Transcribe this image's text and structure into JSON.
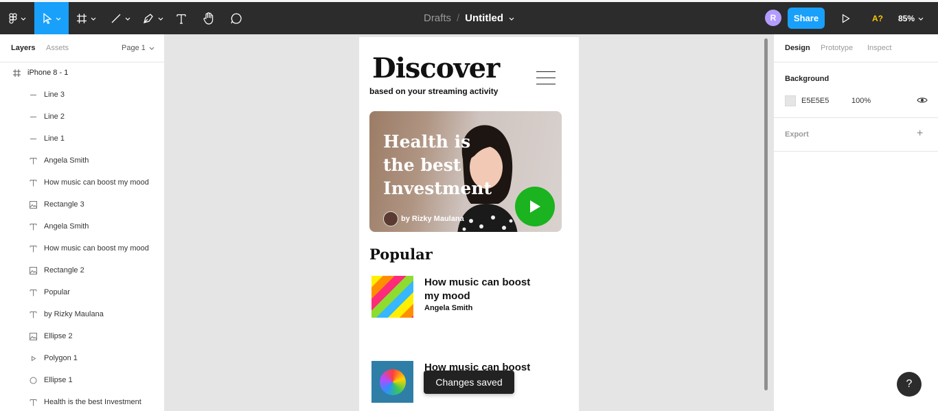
{
  "toolbar": {
    "breadcrumb_drafts": "Drafts",
    "breadcrumb_sep": "/",
    "file_title": "Untitled",
    "avatar_initial": "R",
    "share_label": "Share",
    "a_label": "A?",
    "zoom_level": "85%"
  },
  "left_panel": {
    "tab_layers": "Layers",
    "tab_assets": "Assets",
    "page": "Page 1",
    "frame_layer": "iPhone 8 - 1",
    "layers": [
      {
        "icon": "line-icon",
        "label": "Line 3"
      },
      {
        "icon": "line-icon",
        "label": "Line 2"
      },
      {
        "icon": "line-icon",
        "label": "Line 1"
      },
      {
        "icon": "text-icon",
        "label": "Angela Smith"
      },
      {
        "icon": "text-icon",
        "label": "How music can boost my mood"
      },
      {
        "icon": "image-icon",
        "label": "Rectangle 3"
      },
      {
        "icon": "text-icon",
        "label": "Angela Smith"
      },
      {
        "icon": "text-icon",
        "label": "How music can boost my mood"
      },
      {
        "icon": "image-icon",
        "label": "Rectangle 2"
      },
      {
        "icon": "text-icon",
        "label": "Popular"
      },
      {
        "icon": "text-icon",
        "label": "by Rizky Maulana"
      },
      {
        "icon": "image-icon",
        "label": "Ellipse 2"
      },
      {
        "icon": "polygon-icon",
        "label": "Polygon 1"
      },
      {
        "icon": "ellipse-icon",
        "label": "Ellipse 1"
      },
      {
        "icon": "text-icon",
        "label": "Health is the best Investment"
      }
    ]
  },
  "canvas": {
    "title": "Discover",
    "subtitle": "based on your streaming activity",
    "hero_title_lines": [
      "Health is",
      "the best",
      "Investment"
    ],
    "hero_author": "by Rizky Maulana",
    "popular_heading": "Popular",
    "items": [
      {
        "title_line1": "How music can boost",
        "title_line2": "my mood",
        "author": "Angela Smith"
      },
      {
        "title_line1": "How music can boost",
        "title_line2": "",
        "author": ""
      }
    ],
    "toast": "Changes saved"
  },
  "right_panel": {
    "tab_design": "Design",
    "tab_prototype": "Prototype",
    "tab_inspect": "Inspect",
    "background_label": "Background",
    "background_hex": "E5E5E5",
    "background_opacity": "100%",
    "export_label": "Export",
    "add_symbol": "+"
  },
  "help_symbol": "?",
  "colors": {
    "toolbar": "#2c2c2c",
    "accent": "#18a0fb",
    "play_button": "#1bb31f",
    "canvas": "#e5e5e5"
  }
}
